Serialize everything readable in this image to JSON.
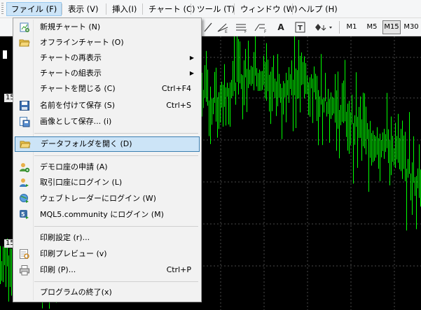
{
  "menubar": {
    "items": [
      {
        "label": "ファイル (F)"
      },
      {
        "label": "表示 (V)"
      },
      {
        "label": "挿入(I)"
      },
      {
        "label": "チャート (C)"
      },
      {
        "label": "ツール (T)"
      },
      {
        "label": "ウィンドウ (W)"
      },
      {
        "label": "ヘルプ (H)"
      }
    ]
  },
  "toolbar": {
    "text_tool": "A",
    "timeframes": [
      "M1",
      "M5",
      "M15",
      "M30"
    ],
    "active_timeframe": "M15"
  },
  "chart": {
    "price_labels": [
      "15",
      "15",
      "15"
    ],
    "candle_color": "#00ff00",
    "background": "#000000"
  },
  "file_menu": {
    "items": [
      {
        "label": "新規チャート (N)",
        "shortcut": "",
        "icon": "new-chart-icon"
      },
      {
        "label": "オフラインチャート (O)",
        "shortcut": "",
        "icon": "folder-open-icon"
      },
      {
        "label": "チャートの再表示",
        "shortcut": "",
        "icon": ""
      },
      {
        "label": "チャートの組表示",
        "shortcut": "",
        "icon": ""
      },
      {
        "label": "チャートを閉じる (C)",
        "shortcut": "Ctrl+F4",
        "icon": ""
      },
      {
        "label": "名前を付けて保存 (S)",
        "shortcut": "Ctrl+S",
        "icon": "save-icon"
      },
      {
        "label": "画像として保存... (i)",
        "shortcut": "",
        "icon": "save-image-icon"
      },
      {
        "label": "データフォルダを開く (D)",
        "shortcut": "",
        "icon": "folder-icon"
      },
      {
        "label": "デモロ座の申請 (A)",
        "shortcut": "",
        "icon": "demo-account-icon"
      },
      {
        "label": "取引口座にログイン (L)",
        "shortcut": "",
        "icon": "login-icon"
      },
      {
        "label": "ウェブトレーダーにログイン (W)",
        "shortcut": "",
        "icon": "webtrader-icon"
      },
      {
        "label": "MQL5.community にログイン (M)",
        "shortcut": "",
        "icon": "mql5-icon"
      },
      {
        "label": "印刷設定 (r)...",
        "shortcut": "",
        "icon": ""
      },
      {
        "label": "印刷プレビュー (v)",
        "shortcut": "",
        "icon": "print-preview-icon"
      },
      {
        "label": "印刷 (P)...",
        "shortcut": "Ctrl+P",
        "icon": "printer-icon"
      },
      {
        "label": "プログラムの終了(x)",
        "shortcut": "",
        "icon": ""
      }
    ]
  }
}
